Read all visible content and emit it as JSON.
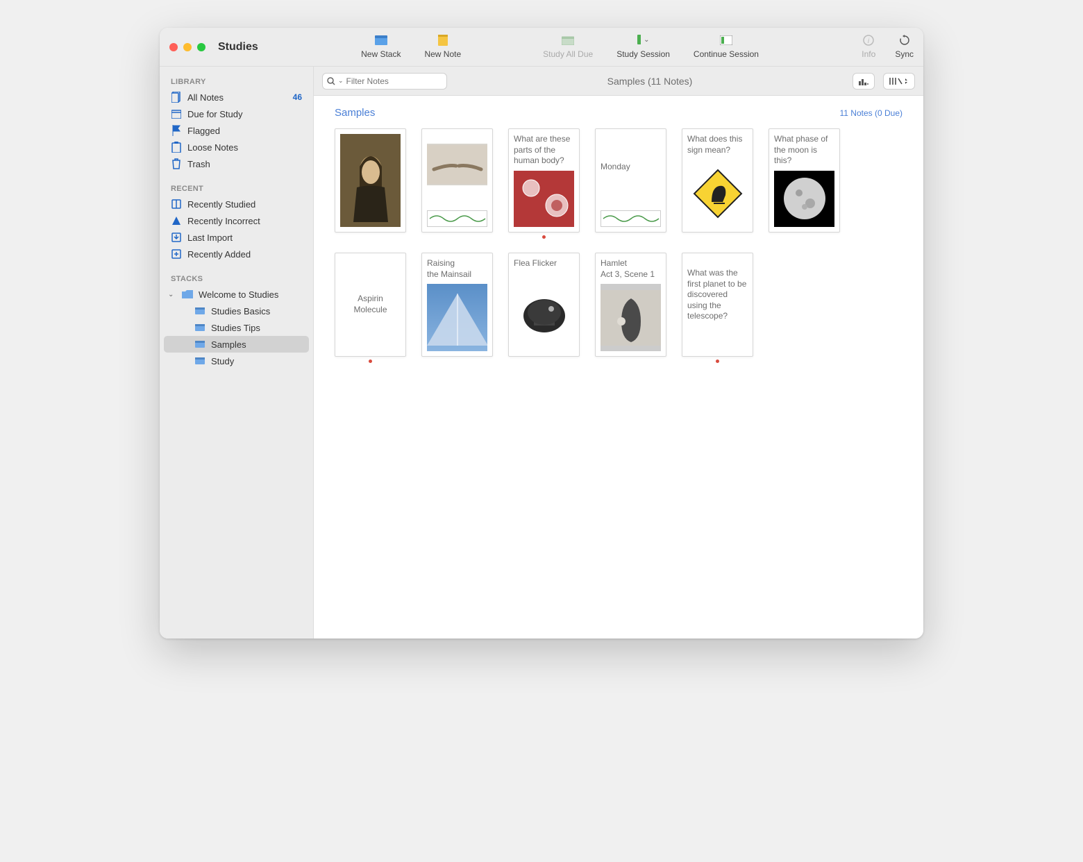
{
  "app_title": "Studies",
  "toolbar": {
    "new_stack": "New Stack",
    "new_note": "New Note",
    "study_all_due": "Study All Due",
    "study_session": "Study Session",
    "continue_session": "Continue Session",
    "info": "Info",
    "sync": "Sync"
  },
  "sidebar": {
    "library_header": "LIBRARY",
    "library": {
      "all_notes": "All Notes",
      "all_notes_count": "46",
      "due_for_study": "Due for Study",
      "flagged": "Flagged",
      "loose_notes": "Loose Notes",
      "trash": "Trash"
    },
    "recent_header": "RECENT",
    "recent": {
      "recently_studied": "Recently Studied",
      "recently_incorrect": "Recently Incorrect",
      "last_import": "Last Import",
      "recently_added": "Recently Added"
    },
    "stacks_header": "STACKS",
    "stacks": {
      "welcome": "Welcome to Studies",
      "basics": "Studies Basics",
      "tips": "Studies Tips",
      "samples": "Samples",
      "study": "Study"
    }
  },
  "main": {
    "filter_placeholder": "Filter Notes",
    "breadcrumb": "Samples (11 Notes)",
    "view_mode": "|||/",
    "stack_name": "Samples",
    "stack_meta": "11 Notes (0 Due)"
  },
  "cards": {
    "c0": "",
    "c1": "",
    "c2": "What are these parts of the human body?",
    "c3": "Monday",
    "c4": "What does this sign mean?",
    "c5": "What phase of the moon is this?",
    "c6": "Aspirin Molecule",
    "c7": "Raising the Mainsail",
    "c8": "Flea Flicker",
    "c9": "Hamlet Act 3, Scene 1",
    "c10": "What was the first planet to be discovered using the telescope?"
  }
}
